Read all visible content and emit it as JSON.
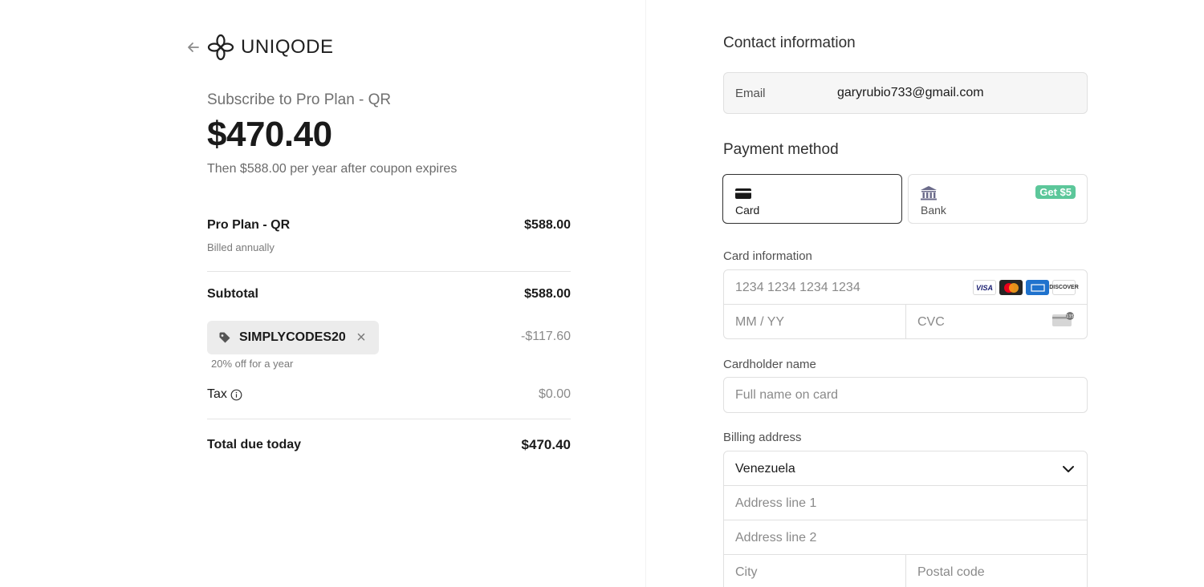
{
  "brand": {
    "name": "UNIQODE"
  },
  "summary": {
    "subscribe_title": "Subscribe to Pro Plan - QR",
    "price": "$470.40",
    "then_text": "Then $588.00 per year after coupon expires",
    "line_item": {
      "name": "Pro Plan - QR",
      "billing": "Billed annually",
      "amount": "$588.00"
    },
    "subtotal": {
      "label": "Subtotal",
      "amount": "$588.00"
    },
    "coupon": {
      "code": "SIMPLYCODES20",
      "discount": "-$117.60",
      "note": "20% off for a year"
    },
    "tax": {
      "label": "Tax",
      "amount": "$0.00"
    },
    "total": {
      "label": "Total due today",
      "amount": "$470.40"
    }
  },
  "contact": {
    "title": "Contact information",
    "email_label": "Email",
    "email_value": "garyrubio733@gmail.com"
  },
  "payment": {
    "title": "Payment method",
    "options": [
      {
        "label": "Card",
        "icon": "credit-card-icon",
        "selected": true
      },
      {
        "label": "Bank",
        "icon": "bank-icon",
        "badge": "Get $5"
      }
    ]
  },
  "card_info": {
    "label": "Card information",
    "number_placeholder": "1234 1234 1234 1234",
    "expiry_placeholder": "MM / YY",
    "cvc_placeholder": "CVC",
    "brands": [
      "VISA",
      "mastercard",
      "amex",
      "DISCOVER"
    ]
  },
  "cardholder": {
    "label": "Cardholder name",
    "placeholder": "Full name on card"
  },
  "billing": {
    "label": "Billing address",
    "country": "Venezuela",
    "address1_placeholder": "Address line 1",
    "address2_placeholder": "Address line 2",
    "city_placeholder": "City",
    "postal_placeholder": "Postal code"
  },
  "colors": {
    "badge": "#5cc79a",
    "selected_border": "#303030"
  }
}
